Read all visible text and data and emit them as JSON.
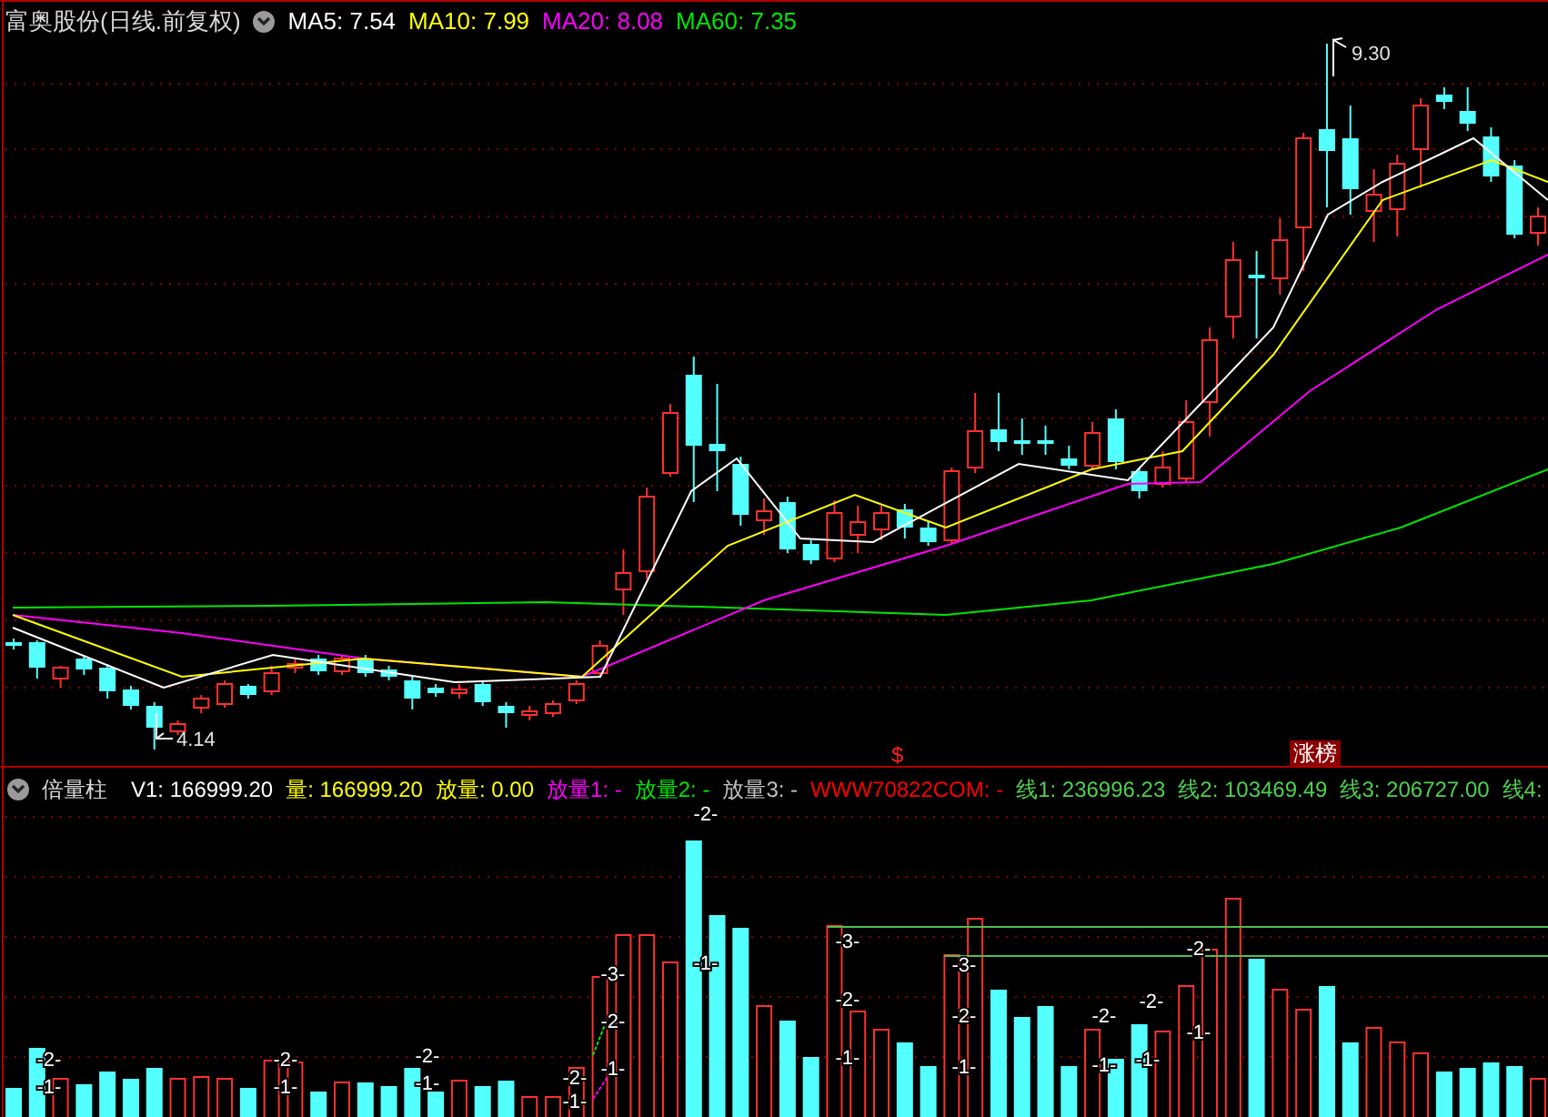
{
  "price_pane": {
    "title": "富奥股份(日线.前复权)",
    "indicators": [
      {
        "label": "MA5: 7.54",
        "color": "#ffffff"
      },
      {
        "label": "MA10: 7.99",
        "color": "#ffff00"
      },
      {
        "label": "MA20: 8.08",
        "color": "#ff00ff"
      },
      {
        "label": "MA60: 7.35",
        "color": "#00e600"
      }
    ],
    "high_label": "9.30",
    "low_label": "4.14",
    "signal_mark": "$",
    "badge": "涨榜"
  },
  "volume_pane": {
    "title": "倍量柱",
    "indicators": [
      {
        "label": "V1: 166999.20",
        "color": "#ffffff"
      },
      {
        "label": "量: 166999.20",
        "color": "#ffff00"
      },
      {
        "label": "放量: 0.00",
        "color": "#ffff00"
      },
      {
        "label": "放量1: -",
        "color": "#ff00ff"
      },
      {
        "label": "放量2: -",
        "color": "#00e600"
      },
      {
        "label": "放量3: -",
        "color": "#c0c0c0"
      },
      {
        "label": "WWW70822COM: -",
        "color": "#ff0000"
      },
      {
        "label": "线1: 236996.23",
        "color": "#4fd04f"
      },
      {
        "label": "线2: 103469.49",
        "color": "#4fd04f"
      },
      {
        "label": "线3: 206727.00",
        "color": "#4fd04f"
      },
      {
        "label": "线4:",
        "color": "#4fd04f"
      }
    ],
    "markers": [
      "-2-",
      "-1-",
      "-2-",
      "-1-",
      "-2-",
      "-1-",
      "-2-",
      "-1-",
      "-3-",
      "-2-",
      "-1-",
      "-2-",
      "-1-",
      "-3-",
      "-2-",
      "-1-",
      "-3-",
      "-2-",
      "-1-",
      "-2-",
      "-1-",
      "-2-",
      "-1-",
      "-2-",
      "-1-"
    ]
  }
}
